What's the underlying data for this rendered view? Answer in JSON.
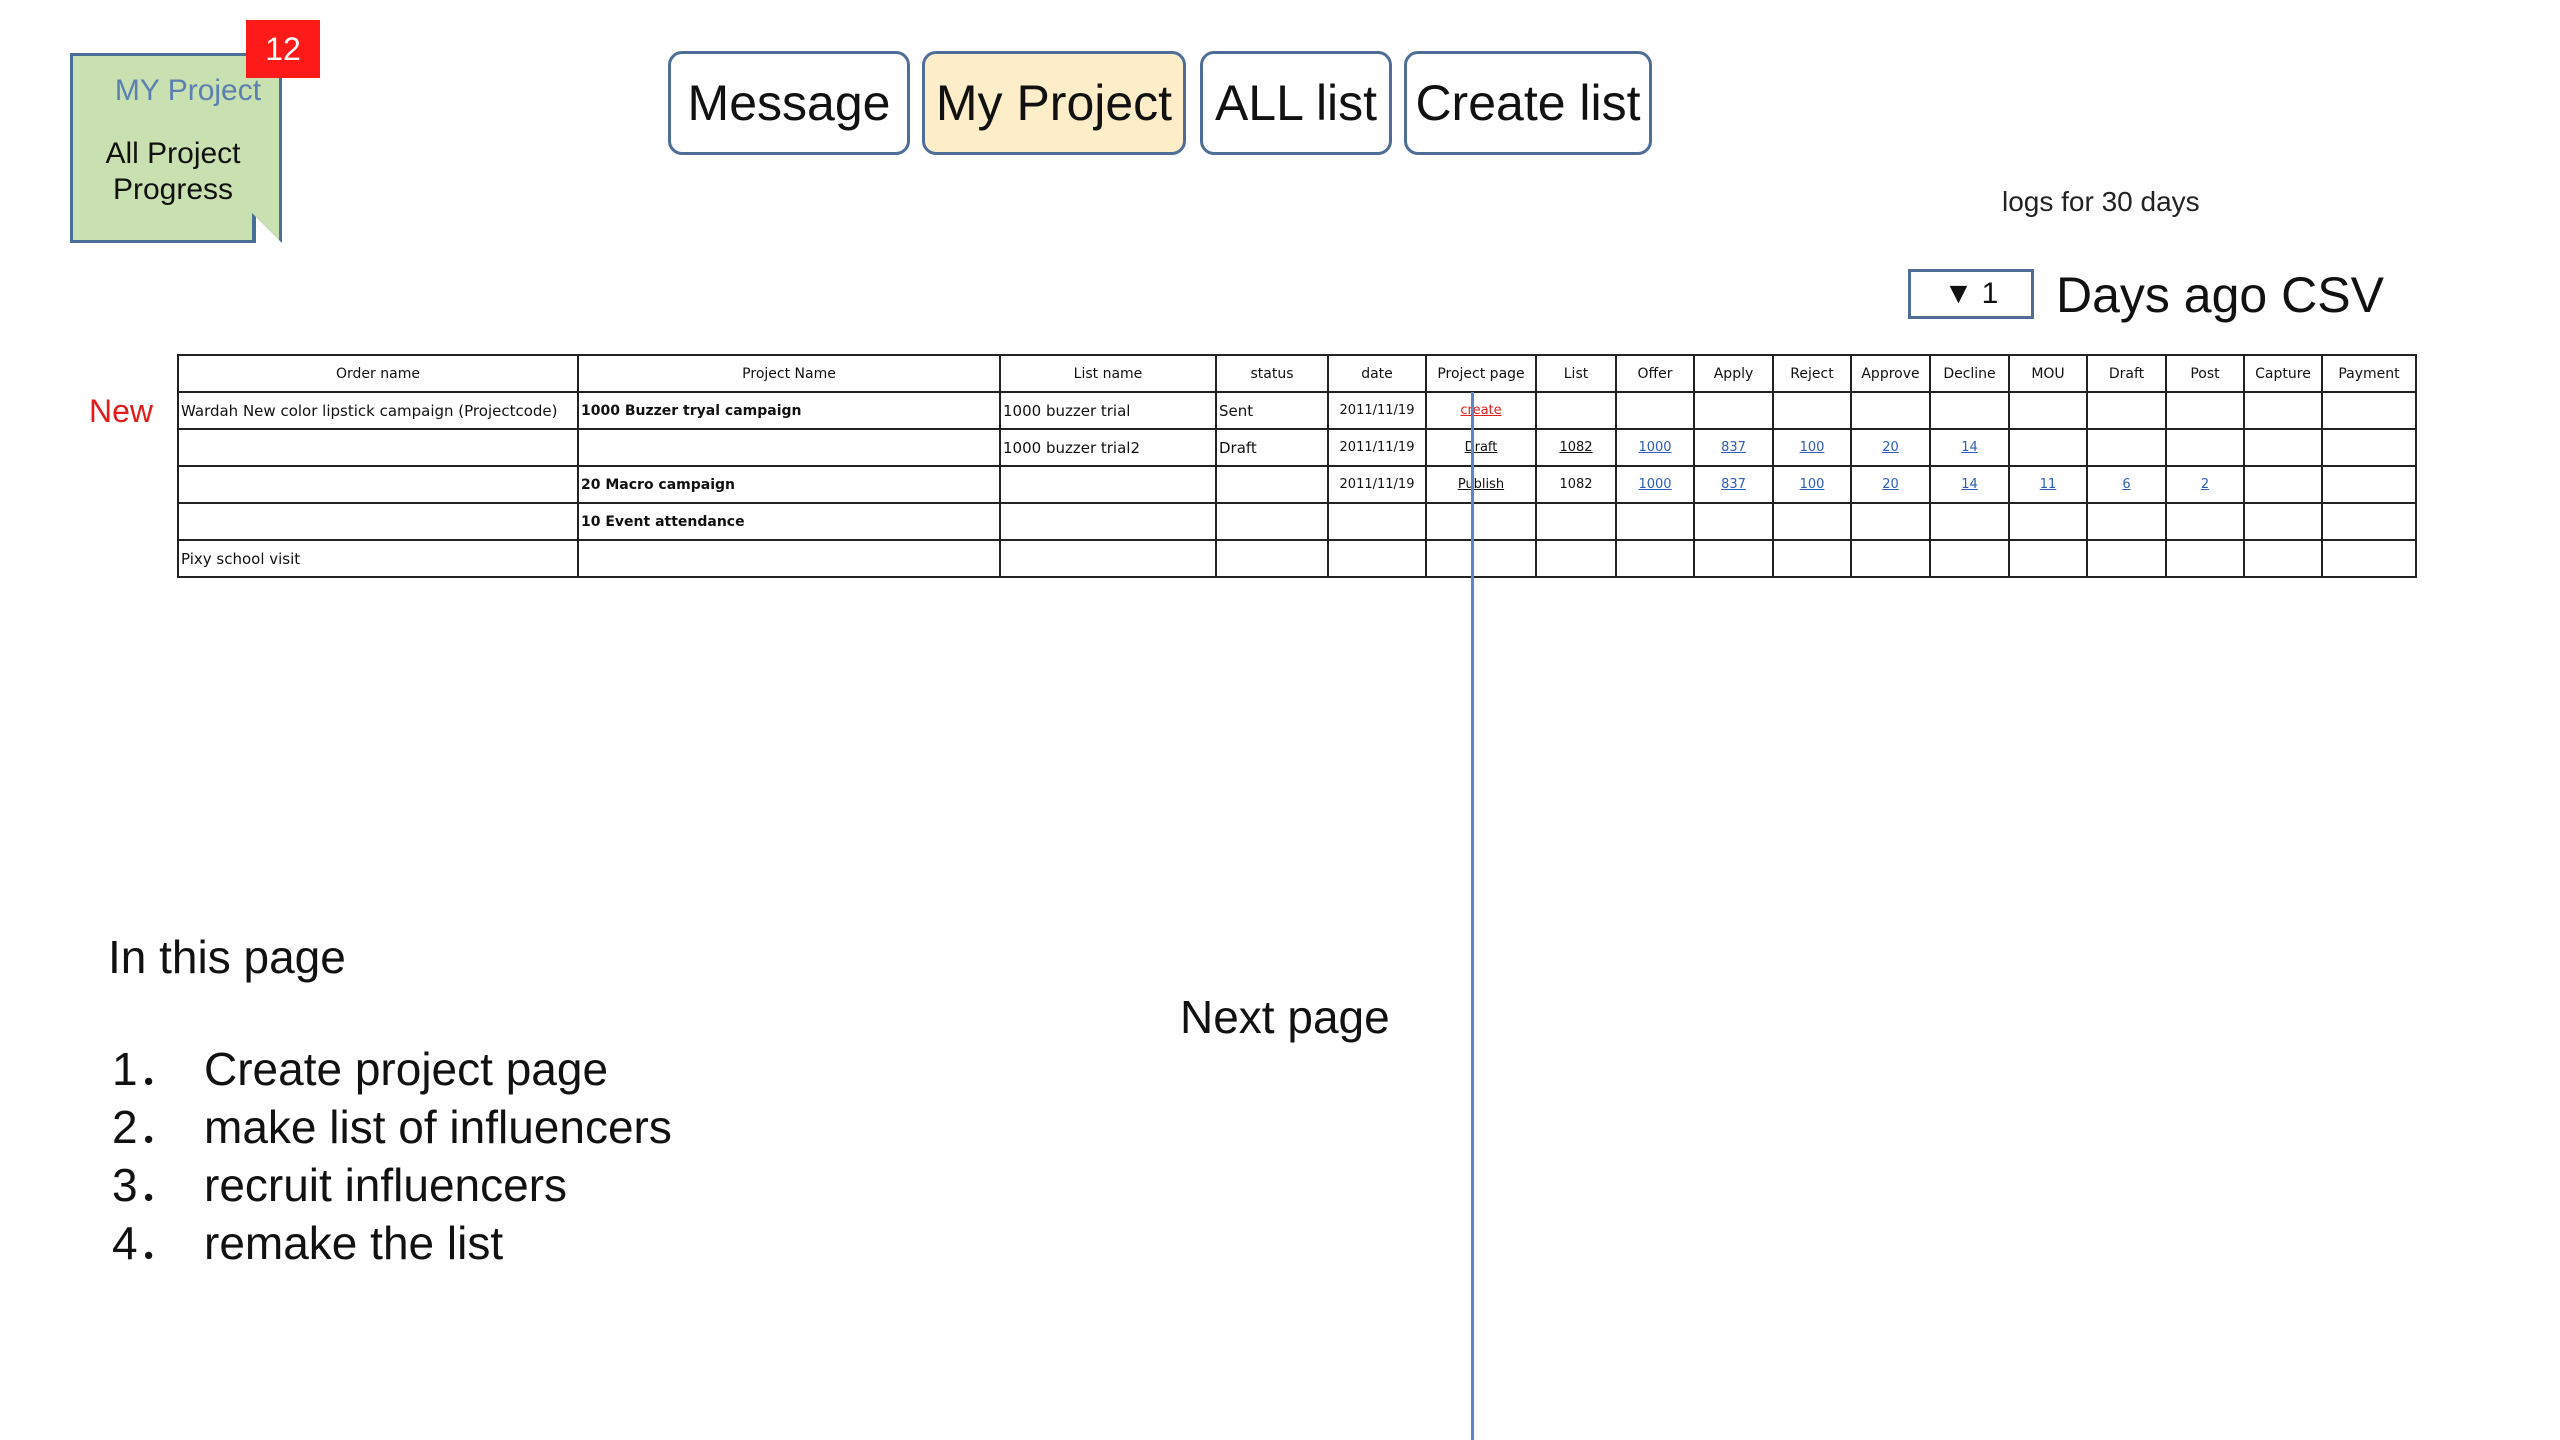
{
  "note": {
    "title": "MY Project",
    "text": "All Project Progress",
    "badge": "12"
  },
  "tabs": [
    {
      "label": "Message",
      "active": false
    },
    {
      "label": "My Project",
      "active": true
    },
    {
      "label": "ALL list",
      "active": false
    },
    {
      "label": "Create list",
      "active": false
    }
  ],
  "logs_label": "logs for 30 days",
  "csv": {
    "select_value": "▼ 1",
    "label": "Days ago CSV"
  },
  "new_label": "New",
  "table": {
    "headers": [
      "Order name",
      "Project Name",
      "List name",
      "status",
      "date",
      "Project page",
      "List",
      "Offer",
      "Apply",
      "Reject",
      "Approve",
      "Decline",
      "MOU",
      "Draft",
      "Post",
      "Capture",
      "Payment"
    ],
    "rows": [
      [
        "Wardah New color lipstick campaign (Projectcode)",
        "1000 Buzzer tryal campaign",
        "1000 buzzer trial",
        "Sent",
        "2011/11/19",
        "create",
        "",
        "",
        "",
        "",
        "",
        "",
        "",
        "",
        "",
        "",
        ""
      ],
      [
        "",
        "",
        "1000 buzzer trial2",
        "Draft",
        "2011/11/19",
        "Draft",
        "1082",
        "1000",
        "837",
        "100",
        "20",
        "14",
        "",
        "",
        "",
        "",
        ""
      ],
      [
        "",
        "20 Macro campaign",
        "",
        "",
        "2011/11/19",
        "Publish",
        "1082",
        "1000",
        "837",
        "100",
        "20",
        "14",
        "11",
        "6",
        "2",
        "",
        ""
      ],
      [
        "",
        "10 Event attendance",
        "",
        "",
        "",
        "",
        "",
        "",
        "",
        "",
        "",
        "",
        "",
        "",
        "",
        "",
        ""
      ],
      [
        "Pixy school visit",
        "",
        "",
        "",
        "",
        "",
        "",
        "",
        "",
        "",
        "",
        "",
        "",
        "",
        "",
        "",
        ""
      ]
    ]
  },
  "intro": "In this page",
  "steps": [
    {
      "n": "1．",
      "text": "Create project page"
    },
    {
      "n": "2．",
      "text": "make list of influencers"
    },
    {
      "n": "3．",
      "text": "recruit influencers"
    },
    {
      "n": "4．",
      "text": "remake the list"
    }
  ],
  "next_page": "Next page",
  "colors": {
    "accent_border": "#4e6e98",
    "active_tab": "#fdedc8",
    "note_bg": "#c9e1b0",
    "badge": "#ff1a1a",
    "new_label": "#e41b1b",
    "link": "#2d5db8"
  }
}
